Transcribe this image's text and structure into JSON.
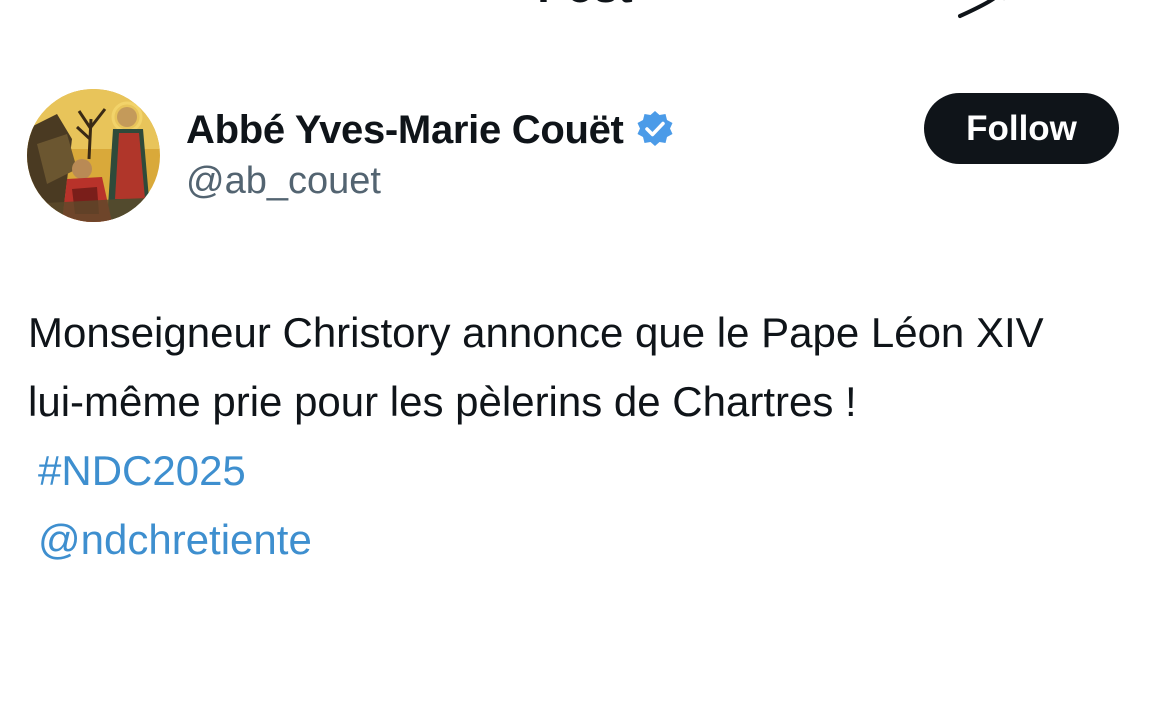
{
  "header": {
    "title": "Post",
    "back_icon": "arrow-left-icon",
    "grok_icon": "grok-icon"
  },
  "author": {
    "name": "Abbé Yves-Marie Couët",
    "handle": "@ab_couet",
    "verified": true,
    "verified_color": "#4b9be8",
    "avatar": "avatar-icon-painting"
  },
  "actions": {
    "follow_label": "Follow"
  },
  "tweet": {
    "text": "Monseigneur Christory annonce que le Pape Léon XIV lui-même prie pour les pèlerins de Chartres !",
    "hashtag": "#NDC2025",
    "mention": "@ndchretiente",
    "link_color": "#3e8fcf"
  }
}
